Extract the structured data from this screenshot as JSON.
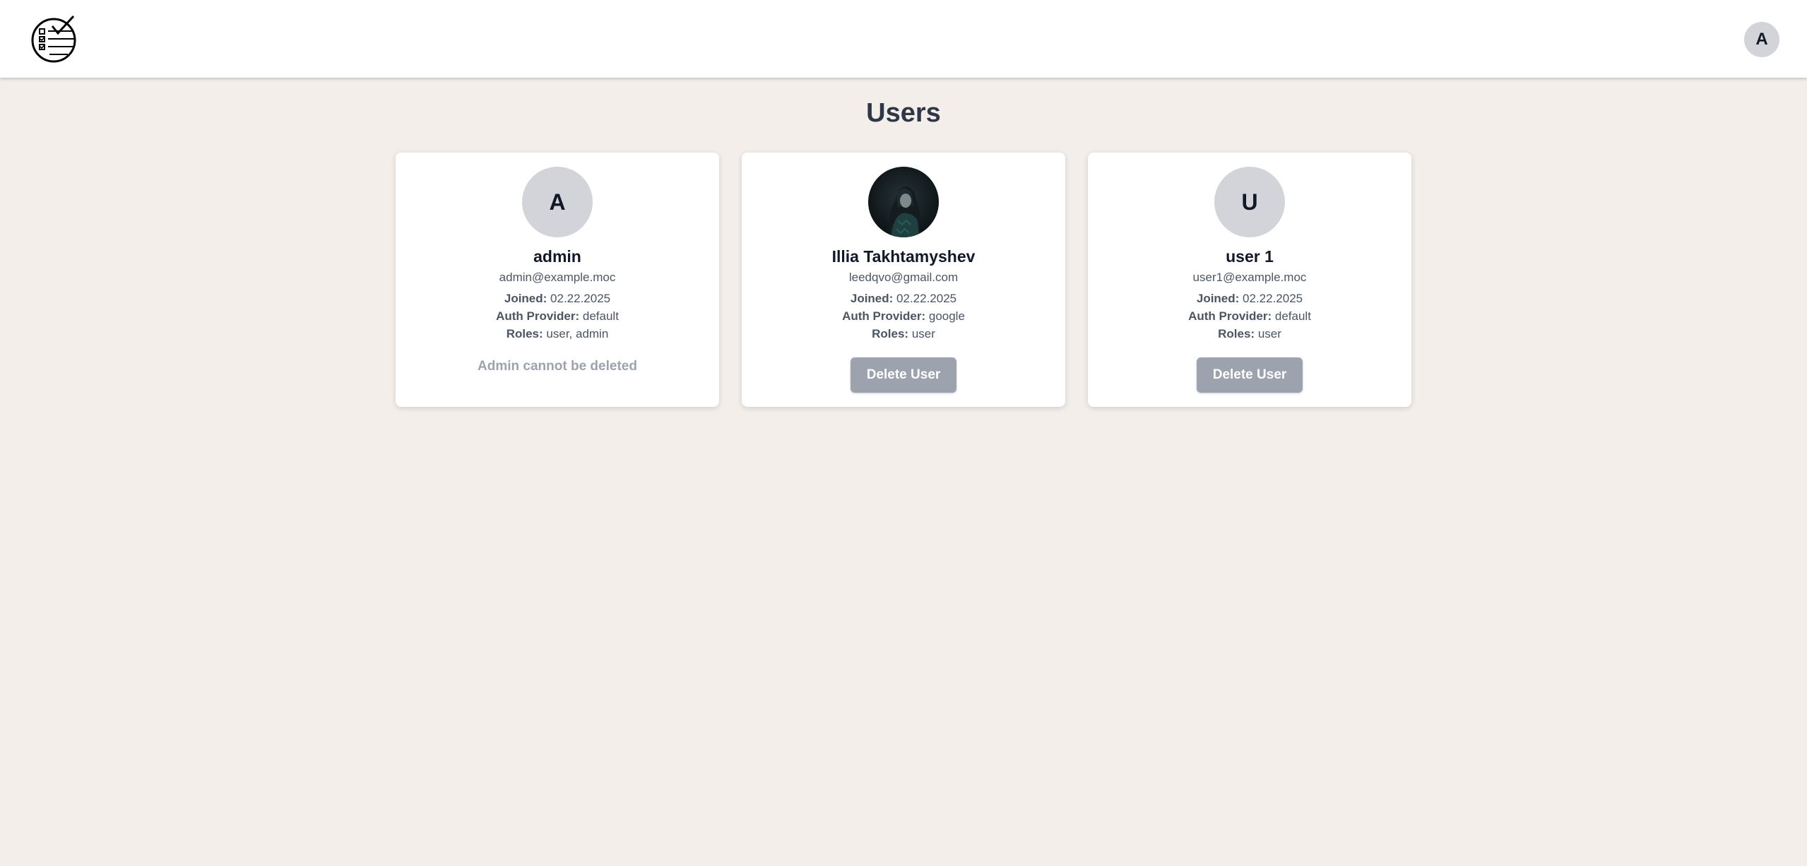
{
  "header": {
    "logo_icon": "checklist-globe-icon",
    "user_avatar_letter": "A"
  },
  "page": {
    "title": "Users"
  },
  "labels": {
    "joined": "Joined:",
    "auth_provider": "Auth Provider:",
    "roles": "Roles:"
  },
  "users": [
    {
      "avatar_letter": "A",
      "name": "admin",
      "email": "admin@example.moc",
      "joined": "02.22.2025",
      "auth_provider": "default",
      "roles": "user, admin",
      "note": "Admin cannot be deleted"
    },
    {
      "avatar_icon": "profile-photo",
      "name": "Illia Takhtamyshev",
      "email": "leedqvo@gmail.com",
      "joined": "02.22.2025",
      "auth_provider": "google",
      "roles": "user",
      "delete_label": "Delete User"
    },
    {
      "avatar_letter": "U",
      "name": "user 1",
      "email": "user1@example.moc",
      "joined": "02.22.2025",
      "auth_provider": "default",
      "roles": "user",
      "delete_label": "Delete User"
    }
  ],
  "colors": {
    "page_background": "#f3eeea",
    "title": "#2d3748",
    "avatar_placeholder": "#d2d4da",
    "button_disabled": "#9ca3af"
  }
}
